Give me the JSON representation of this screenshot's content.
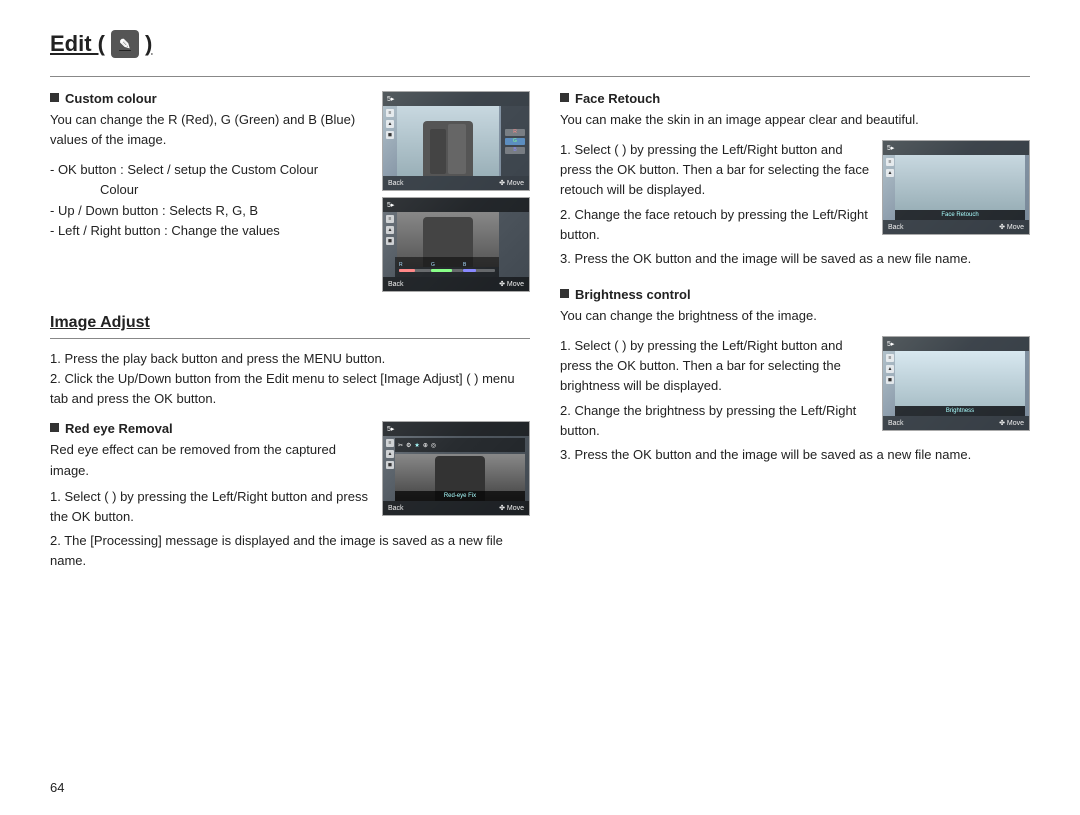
{
  "page": {
    "title": "Edit (",
    "title_icon": "✎",
    "page_number": "64"
  },
  "left_col": {
    "custom_colour": {
      "bullet": "■",
      "heading": "Custom colour",
      "body": "You can change the R (Red), G (Green) and B (Blue) values of the image.",
      "instructions": [
        "- OK button : Select / setup the Custom Colour",
        "- Up / Down button : Selects R, G, B",
        "- Left / Right button : Change the values"
      ]
    },
    "image_adjust": {
      "heading": "Image Adjust",
      "steps": [
        "1. Press the play back button and press the MENU button.",
        "2. Click the Up/Down button from the Edit menu to select [Image Adjust] (   ) menu tab and press the OK button."
      ],
      "red_eye": {
        "bullet": "■",
        "heading": "Red eye Removal",
        "body": "Red eye effect can be removed from the captured image.",
        "steps": [
          "1. Select (   ) by pressing the Left/Right button and press the OK button.",
          "2. The [Processing] message is displayed and the image is saved as a new file name."
        ]
      }
    }
  },
  "right_col": {
    "face_retouch": {
      "bullet": "■",
      "heading": "Face Retouch",
      "body": "You can make the skin in an image appear clear and beautiful.",
      "steps": [
        "1. Select (   ) by pressing the Left/Right button and press the OK button. Then a bar for selecting the face retouch will be displayed.",
        "2. Change the face retouch by pressing the Left/Right button.",
        "3. Press the OK button and the image will be saved as a new file name."
      ]
    },
    "brightness": {
      "bullet": "■",
      "heading": "Brightness control",
      "body": "You can change the brightness of the image.",
      "steps": [
        "1. Select (   ) by pressing the Left/Right button and press the OK button. Then a bar for selecting the brightness will be displayed.",
        "2. Change the brightness by pressing the Left/Right button.",
        "3. Press the OK button and the image will be saved as a new file name."
      ]
    }
  },
  "images": {
    "cam_back_label": "Back",
    "cam_move_label": "Move",
    "face_retouch_label": "Face Retouch",
    "brightness_label": "Brightness",
    "red_eye_label": "Red-eye Fix"
  }
}
